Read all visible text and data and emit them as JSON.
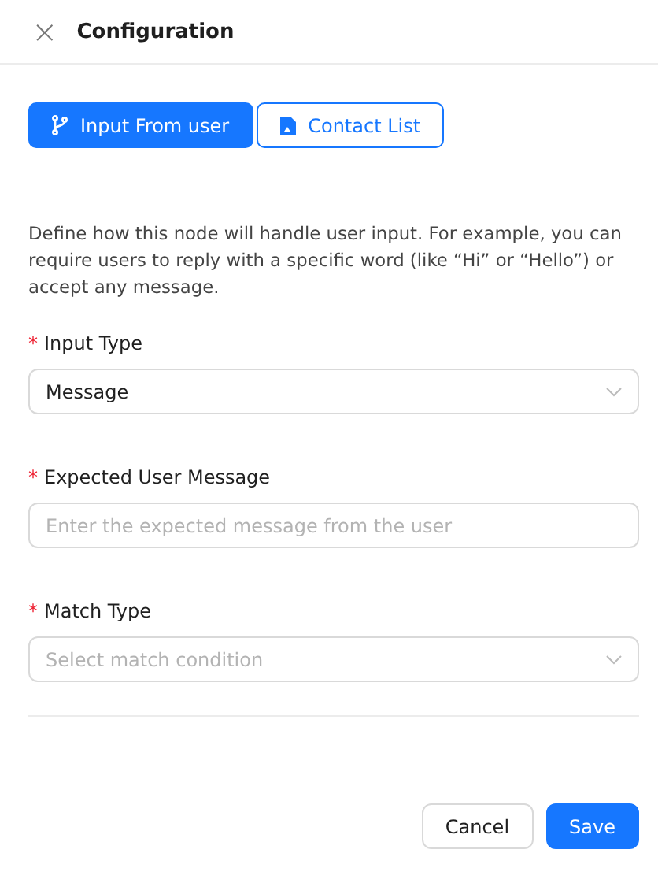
{
  "header": {
    "close": "×",
    "title": "Configuration"
  },
  "tabs": [
    {
      "label": "Input From user",
      "kind": "branch",
      "selected": true
    },
    {
      "label": "Contact List",
      "kind": "document",
      "selected": false
    }
  ],
  "description": "Define how this node will handle user input. For example, you can require users to reply with a specific word (like “Hi” or “Hello”) or accept any message.",
  "fields": [
    {
      "kind": "select",
      "label": "Input Type",
      "required_mark": "*",
      "value": "Message"
    },
    {
      "kind": "text",
      "label": "Expected User Message",
      "required_mark": "*",
      "placeholder": "Enter the expected message from the user"
    },
    {
      "kind": "select",
      "label": "Match Type",
      "required_mark": "*",
      "placeholder": "Select match condition"
    }
  ],
  "buttons": [
    {
      "label": "Cancel",
      "kind": "secondary"
    },
    {
      "label": "Save",
      "kind": "primary"
    }
  ]
}
